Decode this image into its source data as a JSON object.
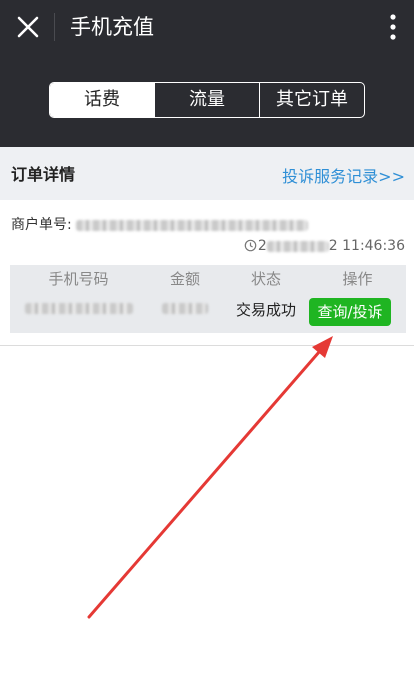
{
  "header": {
    "title": "手机充值"
  },
  "tabs": [
    {
      "label": "话费",
      "active": true
    },
    {
      "label": "流量",
      "active": false
    },
    {
      "label": "其它订单",
      "active": false
    }
  ],
  "section": {
    "title": "订单详情",
    "complaint_link": "投诉服务记录>>"
  },
  "order": {
    "merchant_label": "商户单号:",
    "time_prefix": "2",
    "time_suffix": "2 11:46:36",
    "columns": [
      "手机号码",
      "金额",
      "状态",
      "操作"
    ],
    "status": "交易成功",
    "action_label": "查询/投诉"
  },
  "colors": {
    "header_bg": "#2b2c31",
    "link": "#2f8fd6",
    "action_green": "#1fb522",
    "annotation_arrow": "#e53935"
  },
  "icons": [
    "close-icon",
    "more-vertical-icon",
    "clock-icon",
    "annotation-arrow"
  ]
}
